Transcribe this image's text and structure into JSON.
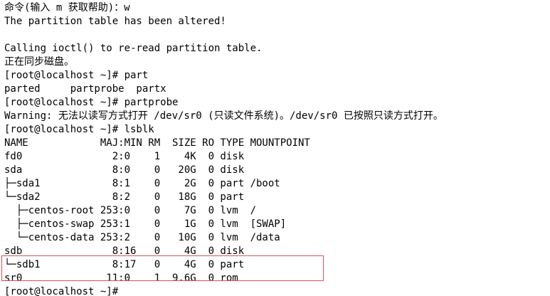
{
  "terminal": {
    "lines": [
      "命令(输入 m 获取帮助)：w",
      "The partition table has been altered!",
      "",
      "Calling ioctl() to re-read partition table.",
      "正在同步磁盘。",
      "[root@localhost ~]# part",
      "parted     partprobe  partx",
      "[root@localhost ~]# partprobe",
      "Warning: 无法以读写方式打开 /dev/sr0 (只读文件系统)。/dev/sr0 已按照只读方式打开。",
      "[root@localhost ~]# lsblk",
      "NAME            MAJ:MIN RM  SIZE RO TYPE MOUNTPOINT",
      "fd0               2:0    1    4K  0 disk",
      "sda               8:0    0   20G  0 disk",
      "├─sda1            8:1    0    2G  0 part /boot",
      "└─sda2            8:2    0   18G  0 part",
      "  ├─centos-root 253:0    0    7G  0 lvm  /",
      "  ├─centos-swap 253:1    0    1G  0 lvm  [SWAP]",
      "  └─centos-data 253:2    0   10G  0 lvm  /data",
      "sdb               8:16   0    4G  0 disk",
      "└─sdb1            8:17   0    4G  0 part",
      "sr0              11:0    1  9.6G  0 rom",
      "[root@localhost ~]#"
    ]
  },
  "colors": {
    "background": "#ffffff",
    "text": "#000000",
    "highlight_border": "#d9534f"
  }
}
